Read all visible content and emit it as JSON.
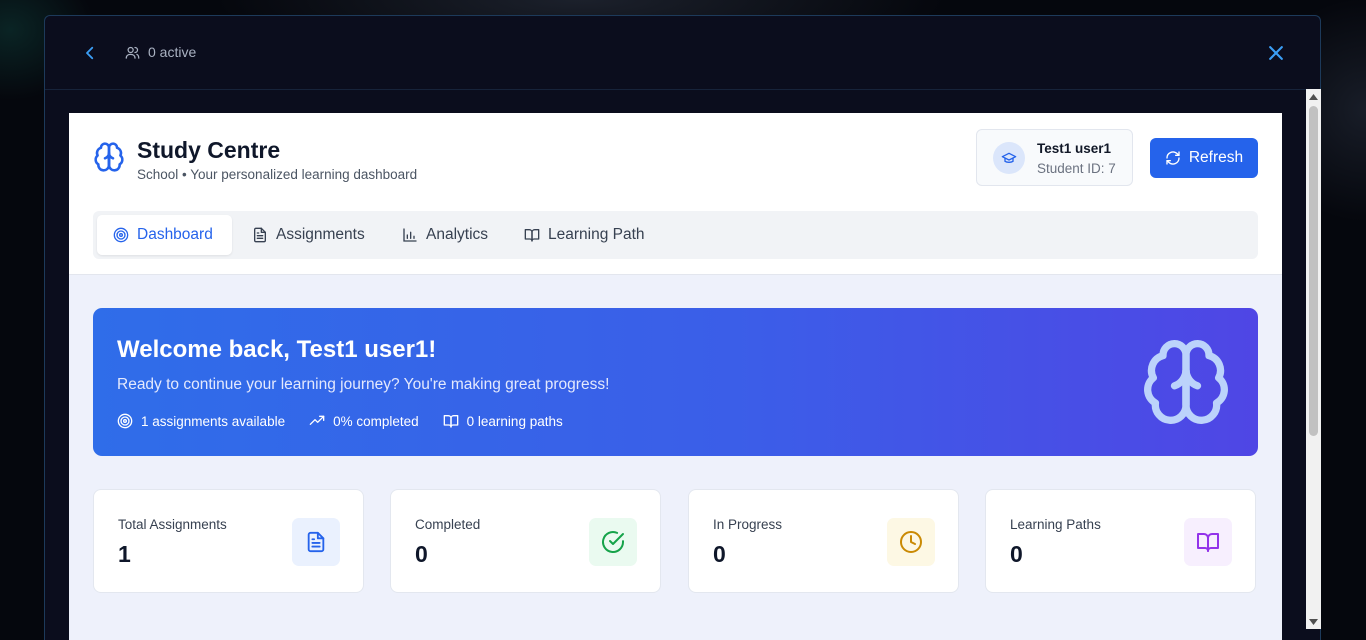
{
  "modal": {
    "active_label": "0 active"
  },
  "app": {
    "title": "Study Centre",
    "subtitle": "School • Your personalized learning dashboard"
  },
  "user": {
    "name": "Test1 user1",
    "student_id": "Student ID: 7"
  },
  "refresh_label": "Refresh",
  "tabs": [
    {
      "label": "Dashboard",
      "icon": "target-icon",
      "active": true
    },
    {
      "label": "Assignments",
      "icon": "document-icon",
      "active": false
    },
    {
      "label": "Analytics",
      "icon": "bar-chart-icon",
      "active": false
    },
    {
      "label": "Learning Path",
      "icon": "book-open-icon",
      "active": false
    }
  ],
  "welcome": {
    "title": "Welcome back, Test1 user1!",
    "subtitle": "Ready to continue your learning journey? You're making great progress!",
    "stats": [
      {
        "label": "1 assignments available",
        "icon": "target-icon"
      },
      {
        "label": "0% completed",
        "icon": "trending-up-icon"
      },
      {
        "label": "0 learning paths",
        "icon": "book-open-icon"
      }
    ]
  },
  "stat_cards": [
    {
      "label": "Total Assignments",
      "value": "1",
      "icon": "document-icon",
      "color": "#2563eb",
      "bg": "#eaf1fe"
    },
    {
      "label": "Completed",
      "value": "0",
      "icon": "check-circle-icon",
      "color": "#16a34a",
      "bg": "#eafaf0"
    },
    {
      "label": "In Progress",
      "value": "0",
      "icon": "clock-icon",
      "color": "#ca8a04",
      "bg": "#fdf8e4"
    },
    {
      "label": "Learning Paths",
      "value": "0",
      "icon": "book-open-icon",
      "color": "#9333ea",
      "bg": "#f7effe"
    }
  ],
  "colors": {
    "accent": "#2563eb",
    "modal_bg": "#0b0d1d",
    "content_bg": "#eef1fb"
  }
}
